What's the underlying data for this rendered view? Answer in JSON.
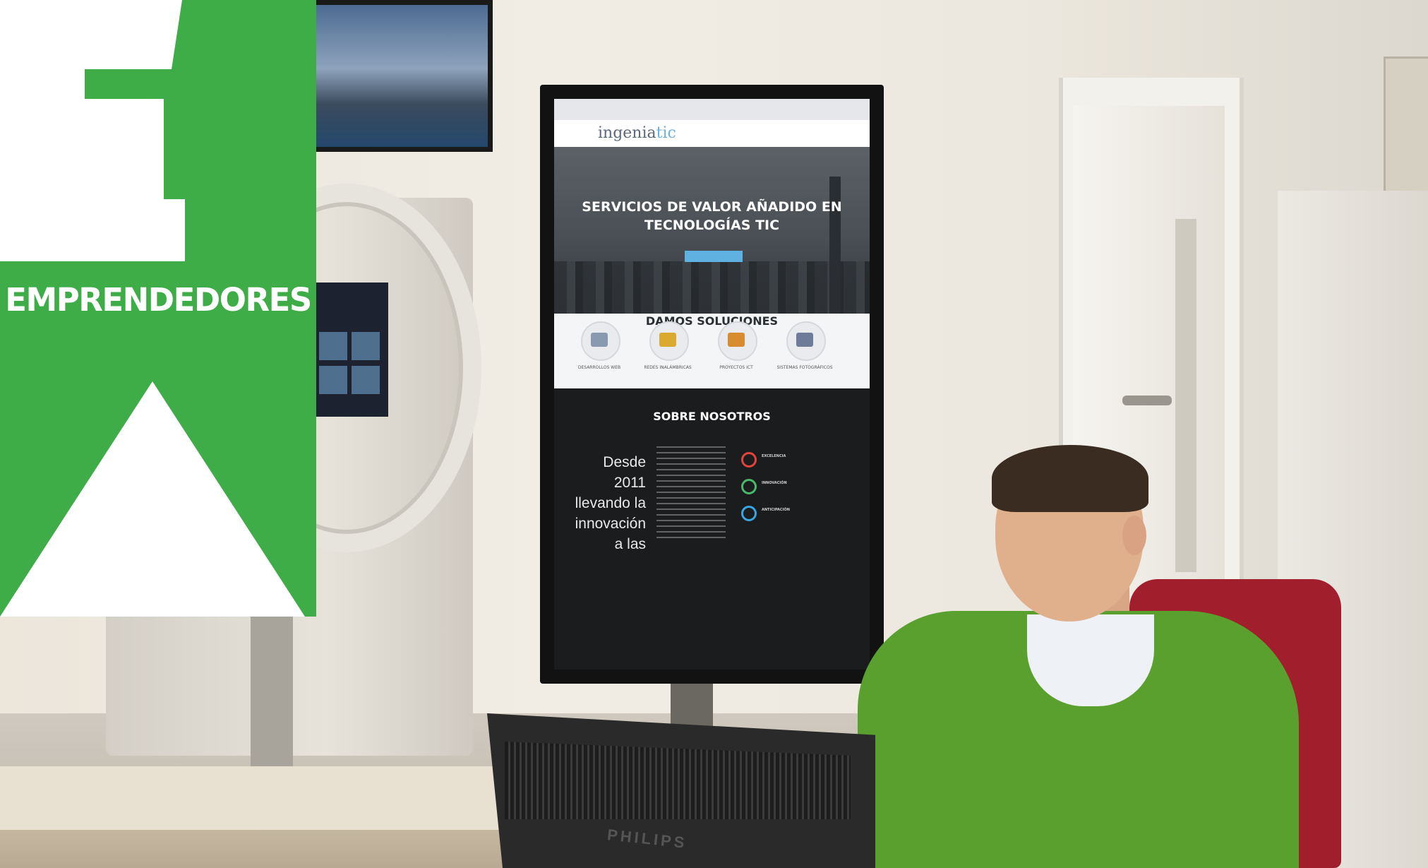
{
  "banner": {
    "word": "EMPRENDEDORES",
    "color": "#3fad47"
  },
  "screen": {
    "logo_main": "ingenia",
    "logo_accent": "tic",
    "hero_title": "SERVICIOS DE VALOR AÑADIDO EN TECNOLOGÍAS TIC",
    "solutions_title": "DAMOS SOLUCIONES",
    "solutions": [
      {
        "label": "DESARROLLOS WEB",
        "color": "#8a9aae"
      },
      {
        "label": "REDES INALÁMBRICAS",
        "color": "#d9a930"
      },
      {
        "label": "PROYECTOS ICT",
        "color": "#d98b30"
      },
      {
        "label": "SISTEMAS FOTOGRÁFICOS",
        "color": "#6f7c99"
      }
    ],
    "about_title": "SOBRE NOSOTROS",
    "about_lines": [
      "Desde",
      "2011",
      "llevando la",
      "innovación",
      "a las"
    ],
    "stats": [
      {
        "label": "EXCELENCIA",
        "color": "#e0443a"
      },
      {
        "label": "INNOVACIÓN",
        "color": "#49b86b"
      },
      {
        "label": "ANTICIPACIÓN",
        "color": "#3aa5e0"
      }
    ]
  },
  "monitor": {
    "brand": "PHILIPS"
  },
  "colors": {
    "sweater": "#5aa02e",
    "chair": "#a11e2d"
  }
}
